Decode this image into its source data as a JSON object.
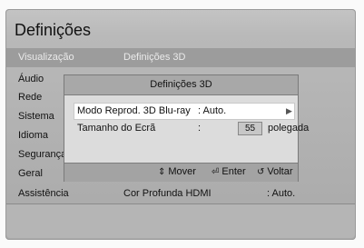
{
  "screen": {
    "title": "Definições",
    "header_row": {
      "left": "Visualização",
      "right": "Definições 3D"
    },
    "menu": [
      "Áudio",
      "Rede",
      "Sistema",
      "Idioma",
      "Segurança",
      "Geral",
      "Assistência"
    ],
    "sub_row": {
      "label": "Cor Profunda HDMI",
      "value": ": Auto."
    }
  },
  "dialog": {
    "title": "Definições 3D",
    "options": [
      {
        "label": "Modo Reprod. 3D Blu-ray",
        "value": ": Auto."
      },
      {
        "label": "Tamanho do Ecrã",
        "colon": ":",
        "number": "55",
        "unit": "polegada"
      }
    ],
    "footer": {
      "move": "Mover",
      "enter": "Enter",
      "back": "Voltar"
    }
  },
  "icons": {
    "move": "updown-arrow-icon",
    "enter": "enter-icon",
    "back": "return-icon",
    "chevron": "chevron-right-icon"
  }
}
